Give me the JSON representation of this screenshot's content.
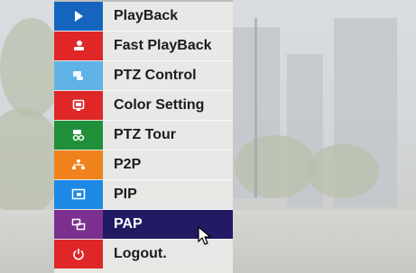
{
  "menu": {
    "items": [
      {
        "label": "PlayBack",
        "icon": "play-icon",
        "color": "#1565c0"
      },
      {
        "label": "Fast PlayBack",
        "icon": "fast-play-icon",
        "color": "#e02727"
      },
      {
        "label": "PTZ Control",
        "icon": "ptz-camera-icon",
        "color": "#5fb3e6"
      },
      {
        "label": "Color Setting",
        "icon": "color-icon",
        "color": "#e02727"
      },
      {
        "label": "PTZ Tour",
        "icon": "ptz-tour-icon",
        "color": "#1f8f3a"
      },
      {
        "label": "P2P",
        "icon": "p2p-icon",
        "color": "#f0821e"
      },
      {
        "label": "PIP",
        "icon": "pip-icon",
        "color": "#1e88e5"
      },
      {
        "label": "PAP",
        "icon": "pap-icon",
        "color": "#7b2f8e"
      },
      {
        "label": "Logout.",
        "icon": "power-icon",
        "color": "#e02727"
      }
    ],
    "active_index": 7
  }
}
